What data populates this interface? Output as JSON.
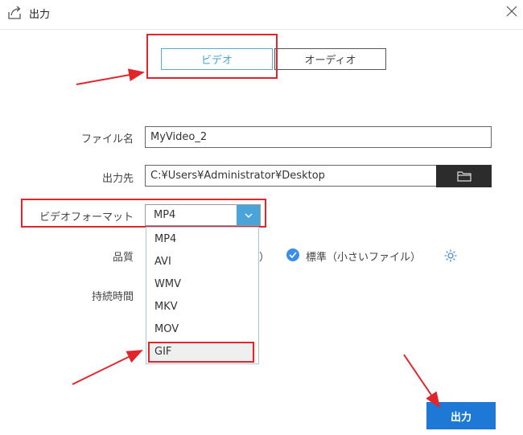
{
  "window": {
    "title": "出力",
    "title_icon": "export-icon",
    "close_icon": "close-icon"
  },
  "tabs": [
    {
      "label": "ビデオ",
      "active": true
    },
    {
      "label": "オーディオ",
      "active": false
    }
  ],
  "form": {
    "filename_label": "ファイル名",
    "filename_value": "MyVideo_2",
    "dest_label": "出力先",
    "dest_value": "C:¥Users¥Administrator¥Desktop",
    "format_label": "ビデオフォーマット",
    "format_value": "MP4",
    "format_options": [
      "MP4",
      "AVI",
      "WMV",
      "MKV",
      "MOV",
      "GIF"
    ],
    "quality_label": "品質",
    "quality_left_fragment": "）",
    "quality_option": "標準（小さいファイル）",
    "duration_label": "持続時間"
  },
  "actions": {
    "export_label": "出力"
  },
  "colors": {
    "accent": "#4aa3d9",
    "button": "#1e79d6",
    "annotation": "#e0262b"
  }
}
